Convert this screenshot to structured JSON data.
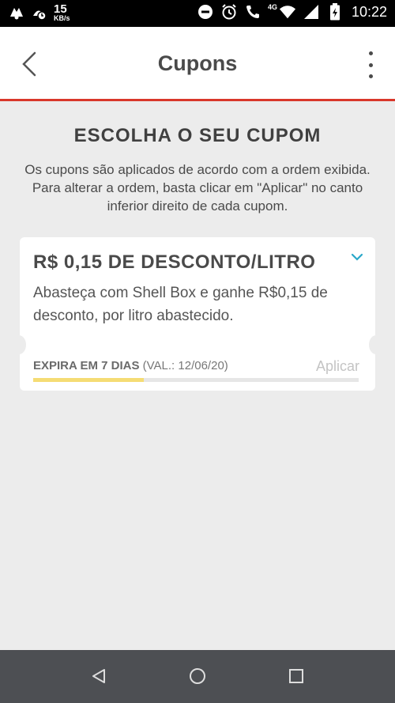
{
  "status_bar": {
    "net_speed_value": "15",
    "net_speed_unit": "KB/s",
    "network_label": "4G",
    "time": "10:22",
    "icons": [
      "notification-icon",
      "notification-icon",
      "dnd-icon",
      "alarm-icon",
      "call-icon",
      "wifi-icon",
      "signal-icon",
      "battery-icon"
    ]
  },
  "app_bar": {
    "title": "Cupons",
    "back_icon": "back-chevron-icon",
    "menu_icon": "more-vert-icon"
  },
  "main": {
    "heading": "ESCOLHA O SEU CUPOM",
    "description": "Os cupons são aplicados de acordo com a ordem exibida. Para alterar a ordem, basta clicar em \"Aplicar\" no canto inferior direito de cada cupom."
  },
  "coupons": [
    {
      "title": "R$ 0,15 DE DESCONTO/LITRO",
      "description": "Abasteça com Shell Box e ganhe R$0,15 de desconto, por litro abastecido.",
      "expiry_label": "EXPIRA EM 7 DIAS",
      "validity": "(VAL.: 12/06/20)",
      "apply_label": "Aplicar",
      "progress": 0.34
    }
  ],
  "colors": {
    "accent": "#d9372a",
    "chevron": "#29a8c9",
    "progress_fill": "#f5dc74",
    "background": "#ececec"
  }
}
